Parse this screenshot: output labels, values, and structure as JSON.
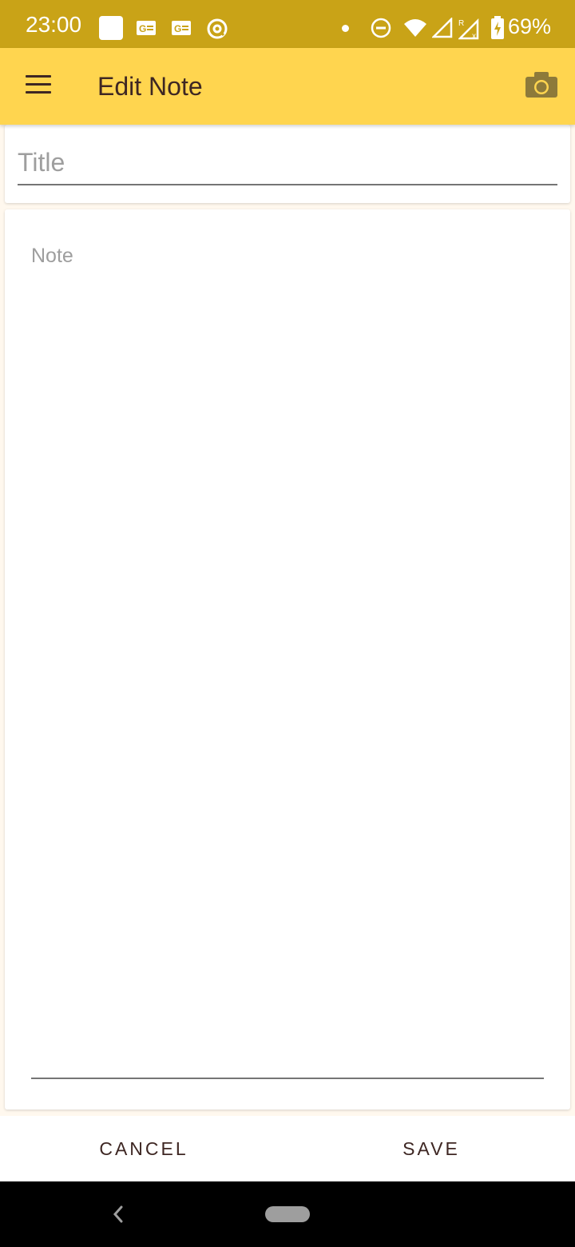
{
  "status_bar": {
    "time": "23:00",
    "battery": "69%",
    "icons": [
      "app-square-icon",
      "gmail-icon",
      "gmail-icon",
      "at-icon",
      "dot-icon",
      "dnd-icon",
      "wifi-icon",
      "signal-icon",
      "signal-roaming-icon",
      "battery-charging-icon"
    ]
  },
  "app_bar": {
    "title": "Edit Note",
    "menu_icon": "hamburger-menu-icon",
    "camera_icon": "camera-icon"
  },
  "form": {
    "title_placeholder": "Title",
    "title_value": "",
    "note_placeholder": "Note",
    "note_value": ""
  },
  "actions": {
    "cancel_label": "CANCEL",
    "save_label": "SAVE"
  },
  "nav": {
    "back_icon": "back-chevron-icon",
    "home_icon": "home-pill-icon"
  },
  "colors": {
    "status_bar": "#c9a317",
    "app_bar": "#ffd54f",
    "text_dark": "#3e2723",
    "camera": "#8d7a3a"
  }
}
